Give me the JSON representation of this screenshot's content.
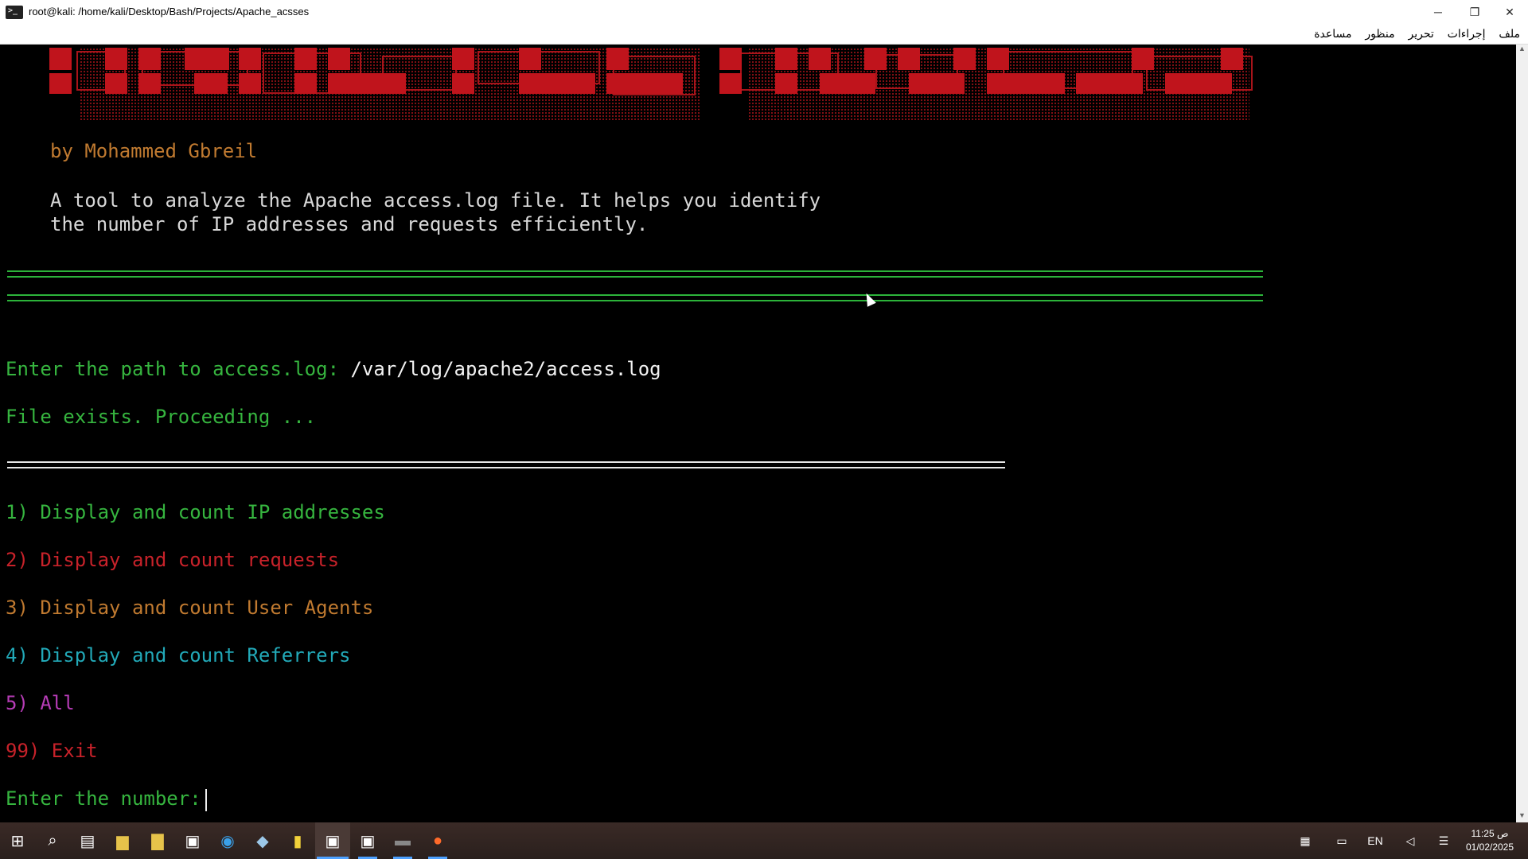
{
  "window": {
    "title": "root@kali: /home/kali/Desktop/Bash/Projects/Apache_acsses"
  },
  "menu": [
    "ملف",
    "إجراءات",
    "تحرير",
    "منظور",
    "مساعدة"
  ],
  "terminal": {
    "author": "by Mohammed Gbreil",
    "description": [
      "A tool to analyze the Apache access.log file. It helps you identify",
      "the number of IP addresses and requests efficiently."
    ],
    "prompt_path": "Enter the path to access.log: ",
    "path_value": "/var/log/apache2/access.log",
    "file_status": "File exists. Proceeding ...",
    "options": [
      "1) Display and count IP addresses",
      "2) Display and count requests",
      "3) Display and count User Agents",
      "4) Display and count Referrers",
      "5) All",
      "99) Exit"
    ],
    "prompt_number": "Enter the number: "
  },
  "taskbar": {
    "lang": "EN",
    "time": "11:25 ص",
    "date": "01/02/2025"
  },
  "colors": {
    "terminal_green": "#36b53f",
    "banner_red": "#c0141c"
  }
}
